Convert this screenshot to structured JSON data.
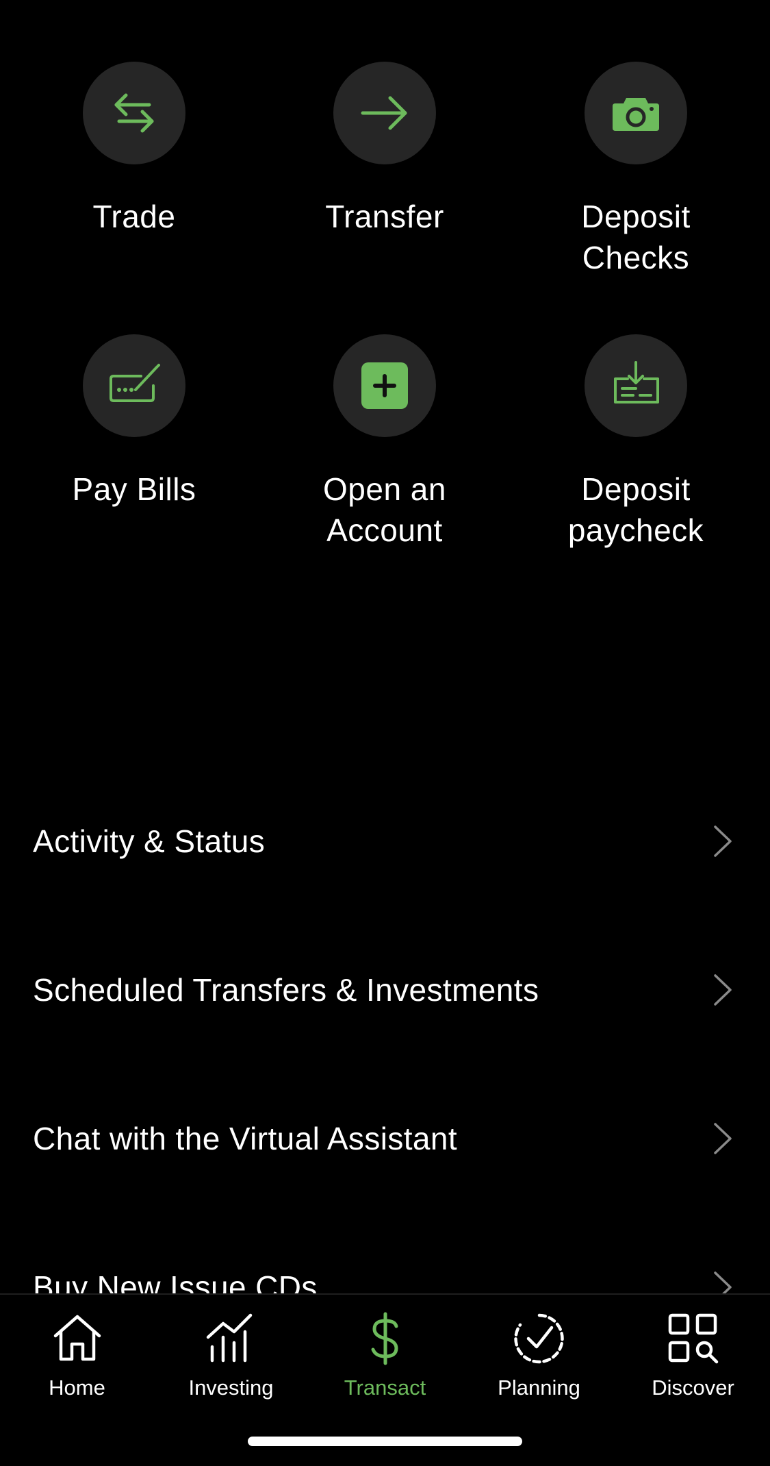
{
  "accent_color": "#6dbb5c",
  "quick_actions": [
    {
      "label": "Trade",
      "icon": "swap-arrows-icon"
    },
    {
      "label": "Transfer",
      "icon": "arrow-right-icon"
    },
    {
      "label": "Deposit\nChecks",
      "icon": "camera-icon"
    },
    {
      "label": "Pay Bills",
      "icon": "bill-pay-icon"
    },
    {
      "label": "Open an\nAccount",
      "icon": "plus-square-icon"
    },
    {
      "label": "Deposit\npaycheck",
      "icon": "paycheck-download-icon"
    }
  ],
  "menu": [
    {
      "label": "Activity & Status"
    },
    {
      "label": "Scheduled Transfers & Investments"
    },
    {
      "label": "Chat with the Virtual Assistant"
    },
    {
      "label": "Buy New Issue CDs"
    }
  ],
  "tabs": [
    {
      "label": "Home",
      "icon": "home-icon"
    },
    {
      "label": "Investing",
      "icon": "investing-chart-icon"
    },
    {
      "label": "Transact",
      "icon": "dollar-icon",
      "active": true
    },
    {
      "label": "Planning",
      "icon": "planning-check-icon"
    },
    {
      "label": "Discover",
      "icon": "discover-grid-search-icon"
    }
  ]
}
